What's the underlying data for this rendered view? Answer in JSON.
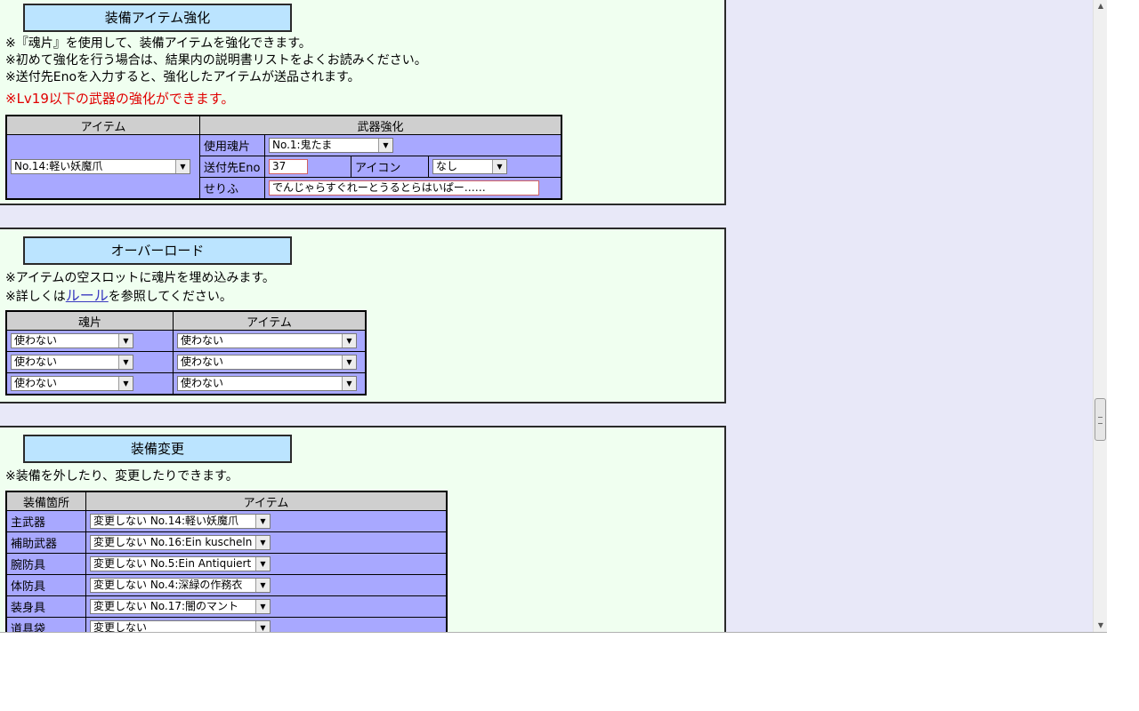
{
  "enhance": {
    "title": "装備アイテム強化",
    "notes": [
      "※『魂片』を使用して、装備アイテムを強化できます。",
      "※初めて強化を行う場合は、結果内の説明書リストをよくお読みください。",
      "※送付先Enoを入力すると、強化したアイテムが送品されます。"
    ],
    "warning": "※Lv19以下の武器の強化ができます。",
    "header_item": "アイテム",
    "header_weapon": "武器強化",
    "item_select": "No.14:軽い妖魔爪",
    "soul_label": "使用魂片",
    "soul_select": "No.1:鬼たま",
    "eno_label": "送付先Eno",
    "eno_value": "37",
    "icon_label": "アイコン",
    "icon_select": "なし",
    "line_label": "せりふ",
    "line_value": "でんじゃらすぐれーとうるとらはいぱー……"
  },
  "overload": {
    "title": "オーバーロード",
    "note1": "※アイテムの空スロットに魂片を埋め込みます。",
    "note2_pre": "※詳しくは",
    "note2_link": "ルール",
    "note2_post": "を参照してください。",
    "header_soul": "魂片",
    "header_item": "アイテム",
    "rows": [
      {
        "soul": "使わない",
        "item": "使わない"
      },
      {
        "soul": "使わない",
        "item": "使わない"
      },
      {
        "soul": "使わない",
        "item": "使わない"
      }
    ]
  },
  "equip": {
    "title": "装備変更",
    "note": "※装備を外したり、変更したりできます。",
    "header_slot": "装備箇所",
    "header_item": "アイテム",
    "rows": [
      {
        "slot": "主武器",
        "item": "変更しない No.14:軽い妖魔爪"
      },
      {
        "slot": "補助武器",
        "item": "変更しない No.16:Ein kuscheln"
      },
      {
        "slot": "腕防具",
        "item": "変更しない No.5:Ein Antiquiert"
      },
      {
        "slot": "体防具",
        "item": "変更しない No.4:深緑の作務衣"
      },
      {
        "slot": "装身具",
        "item": "変更しない No.17:闇のマント"
      },
      {
        "slot": "道具袋",
        "item": "変更しない"
      }
    ]
  },
  "icons": {
    "dropdown": "chevron-down-icon",
    "scroll_up": "arrow-up-icon",
    "scroll_down": "arrow-down-icon"
  }
}
